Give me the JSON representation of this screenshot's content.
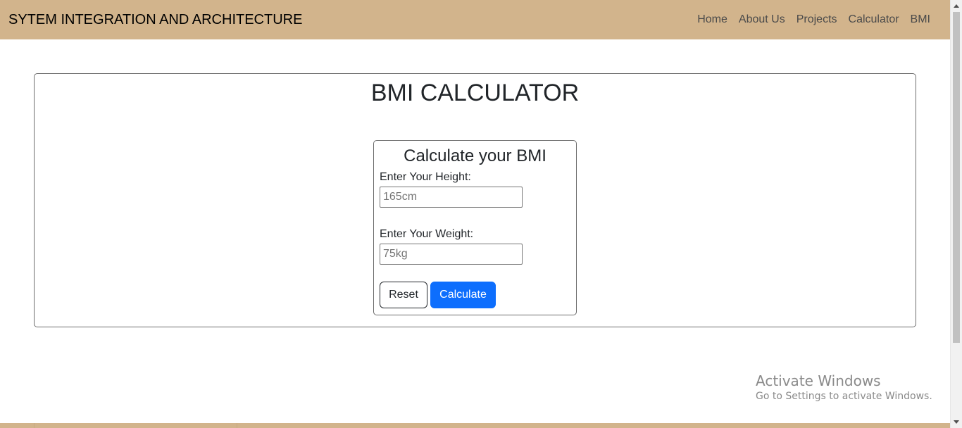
{
  "navbar": {
    "brand": "SYTEM INTEGRATION AND ARCHITECTURE",
    "links": [
      "Home",
      "About Us",
      "Projects",
      "Calculator",
      "BMI"
    ],
    "background": "#d2b48c"
  },
  "main": {
    "title": "BMI CALCULATOR",
    "form": {
      "title": "Calculate your BMI",
      "height_label": "Enter Your Height:",
      "height_placeholder": "165cm",
      "weight_label": "Enter Your Weight:",
      "weight_placeholder": "75kg",
      "reset_label": "Reset",
      "calculate_label": "Calculate",
      "calculate_color": "#0d6efd"
    }
  },
  "watermark": {
    "title": "Activate Windows",
    "subtitle": "Go to Settings to activate Windows."
  },
  "icons": {
    "scroll_up": "chevron-up-icon",
    "scroll_down": "chevron-down-icon"
  }
}
